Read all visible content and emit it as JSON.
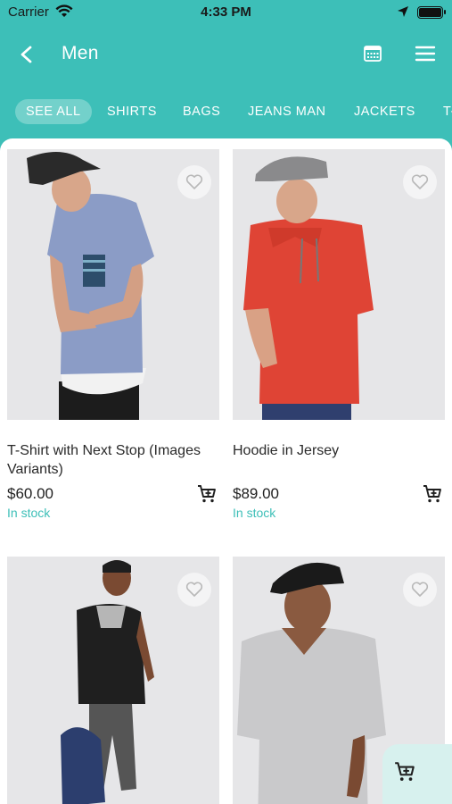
{
  "status": {
    "carrier": "Carrier",
    "time": "4:33 PM"
  },
  "nav": {
    "title": "Men",
    "icons": [
      "back-arrow-icon",
      "calendar-icon",
      "menu-icon"
    ]
  },
  "categories": {
    "items": [
      {
        "label": "SEE ALL",
        "active": true
      },
      {
        "label": "SHIRTS"
      },
      {
        "label": "BAGS"
      },
      {
        "label": "JEANS MAN"
      },
      {
        "label": "JACKETS"
      },
      {
        "label": "T-"
      }
    ]
  },
  "products": [
    {
      "name": "T-Shirt with Next Stop (Images Variants)",
      "price": "$60.00",
      "stock": "In stock"
    },
    {
      "name": "Hoodie in Jersey",
      "price": "$89.00",
      "stock": "In stock"
    },
    {
      "name": "",
      "price": "",
      "stock": ""
    },
    {
      "name": "",
      "price": "",
      "stock": ""
    }
  ],
  "colors": {
    "accent": "#3dbfb8",
    "header_bg": "#3dbfb8",
    "card_bg": "#e8e8e9",
    "fab_bg": "#d7f1ee"
  }
}
